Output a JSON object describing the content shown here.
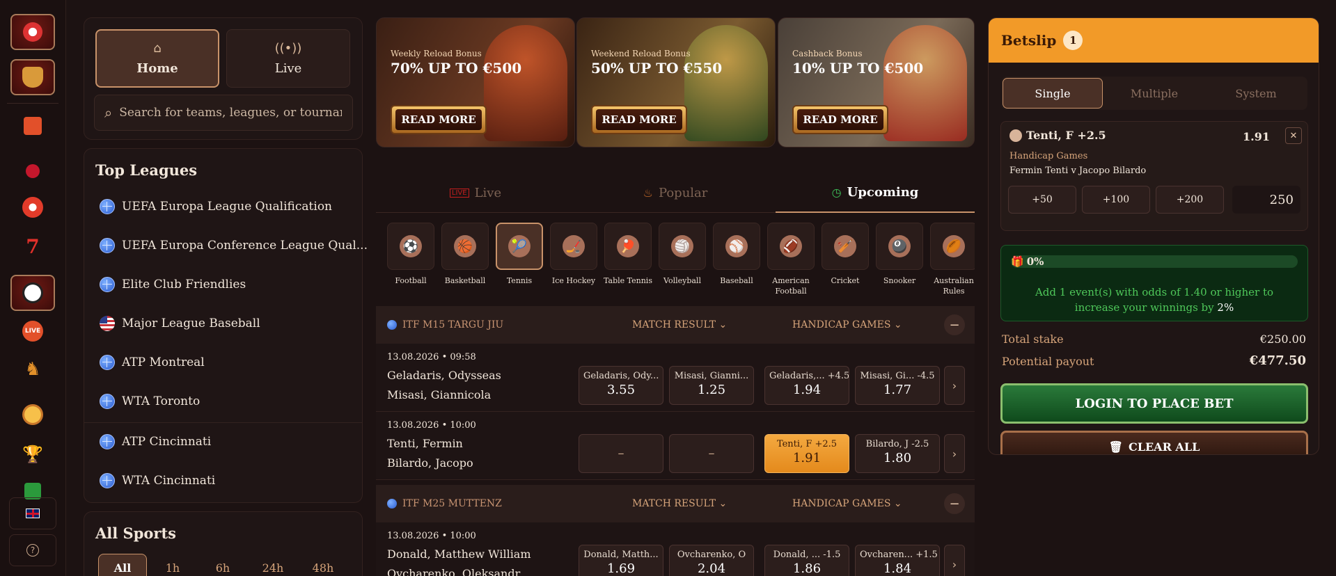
{
  "rail": {
    "icons": [
      "casino-chip-icon",
      "slot-basket-icon",
      "gift-icon",
      "cherry-icon",
      "roulette-icon",
      "seven-icon",
      "football-icon",
      "live-icon",
      "chess-knight-icon",
      "medal-icon",
      "trophy-icon",
      "card-icon",
      "uk-flag-icon",
      "help-icon"
    ],
    "live_label": "LIVE"
  },
  "nav": {
    "home_label": "Home",
    "live_label": "Live",
    "search_placeholder": "Search for teams, leagues, or tournaments"
  },
  "top_leagues": {
    "title": "Top Leagues",
    "items": [
      {
        "label": "UEFA Europa League Qualification",
        "icon": "globe"
      },
      {
        "label": "UEFA Europa Conference League Qual...",
        "icon": "globe"
      },
      {
        "label": "Elite Club Friendlies",
        "icon": "globe"
      },
      {
        "label": "Major League Baseball",
        "icon": "us-flag"
      },
      {
        "label": "ATP Montreal",
        "icon": "globe"
      },
      {
        "label": "WTA Toronto",
        "icon": "globe"
      },
      {
        "label": "ATP Cincinnati",
        "icon": "globe"
      },
      {
        "label": "WTA Cincinnati",
        "icon": "globe"
      }
    ]
  },
  "all_sports": {
    "title": "All Sports",
    "filters": [
      "All",
      "1h",
      "6h",
      "24h",
      "48h"
    ]
  },
  "promos": [
    {
      "subtitle": "Weekly Reload Bonus",
      "headline": "70% UP TO €500",
      "button": "READ MORE"
    },
    {
      "subtitle": "Weekend Reload Bonus",
      "headline": "50% UP TO €550",
      "button": "READ MORE"
    },
    {
      "subtitle": "Cashback Bonus",
      "headline": "10% UP TO €500",
      "button": "READ MORE"
    }
  ],
  "tabs": {
    "live": "Live",
    "popular": "Popular",
    "upcoming": "Upcoming"
  },
  "sports": [
    {
      "name": "Football",
      "icon": "⚽"
    },
    {
      "name": "Basketball",
      "icon": "🏀"
    },
    {
      "name": "Tennis",
      "icon": "🎾"
    },
    {
      "name": "Ice Hockey",
      "icon": "🏒"
    },
    {
      "name": "Table Tennis",
      "icon": "🏓"
    },
    {
      "name": "Volleyball",
      "icon": "🏐"
    },
    {
      "name": "Baseball",
      "icon": "⚾"
    },
    {
      "name": "American Football",
      "icon": "🏈"
    },
    {
      "name": "Cricket",
      "icon": "🏏"
    },
    {
      "name": "Snooker",
      "icon": "🎱"
    },
    {
      "name": "Australian Rules",
      "icon": "🏉"
    }
  ],
  "groups": [
    {
      "title": "ITF M15 TARGU JIU",
      "col1": "MATCH RESULT",
      "col2": "HANDICAP GAMES",
      "matches": [
        {
          "date": "13.08.2026 • 09:58",
          "p1": "Geladaris, Odysseas",
          "p2": "Misasi, Giannicola",
          "odds": [
            {
              "label": "Geladaris, Ody...",
              "value": "3.55"
            },
            {
              "label": "Misasi, Gianni...",
              "value": "1.25"
            },
            {
              "label": "Geladaris,...  +4.5",
              "value": "1.94"
            },
            {
              "label": "Misasi, Gi...  -4.5",
              "value": "1.77"
            }
          ]
        },
        {
          "date": "13.08.2026 • 10:00",
          "p1": "Tenti, Fermin",
          "p2": "Bilardo, Jacopo",
          "odds": [
            {
              "label": "",
              "value": "–"
            },
            {
              "label": "",
              "value": "–"
            },
            {
              "label": "Tenti, F +2.5",
              "value": "1.91"
            },
            {
              "label": "Bilardo, J -2.5",
              "value": "1.80"
            }
          ]
        }
      ]
    },
    {
      "title": "ITF M25 MUTTENZ",
      "col1": "MATCH RESULT",
      "col2": "HANDICAP GAMES",
      "matches": [
        {
          "date": "13.08.2026 • 10:00",
          "p1": "Donald, Matthew William",
          "p2": "Ovcharenko, Oleksandr",
          "odds": [
            {
              "label": "Donald, Matth...",
              "value": "1.69"
            },
            {
              "label": "Ovcharenko, O",
              "value": "2.04"
            },
            {
              "label": "Donald, ...     -1.5",
              "value": "1.86"
            },
            {
              "label": "Ovcharen... +1.5",
              "value": "1.84"
            }
          ]
        }
      ]
    }
  ],
  "betslip": {
    "title": "Betslip",
    "count": "1",
    "tabs": [
      "Single",
      "Multiple",
      "System"
    ],
    "selection": "Tenti, F +2.5",
    "odds": "1.91",
    "market": "Handicap Games",
    "event": "Fermin Tenti v Jacopo Bilardo",
    "quick": [
      "+50",
      "+100",
      "+200"
    ],
    "stake": "250",
    "boost_pct": "0%",
    "boost_msg_pre": "Add 1 event(s) with odds of 1.40 or higher to increase your winnings by ",
    "boost_msg_val": "2%",
    "total_stake_label": "Total stake",
    "total_stake": "€250.00",
    "payout_label": "Potential payout",
    "payout": "€477.50",
    "login_btn": "LOGIN TO PLACE BET",
    "clear_btn": "CLEAR ALL"
  }
}
